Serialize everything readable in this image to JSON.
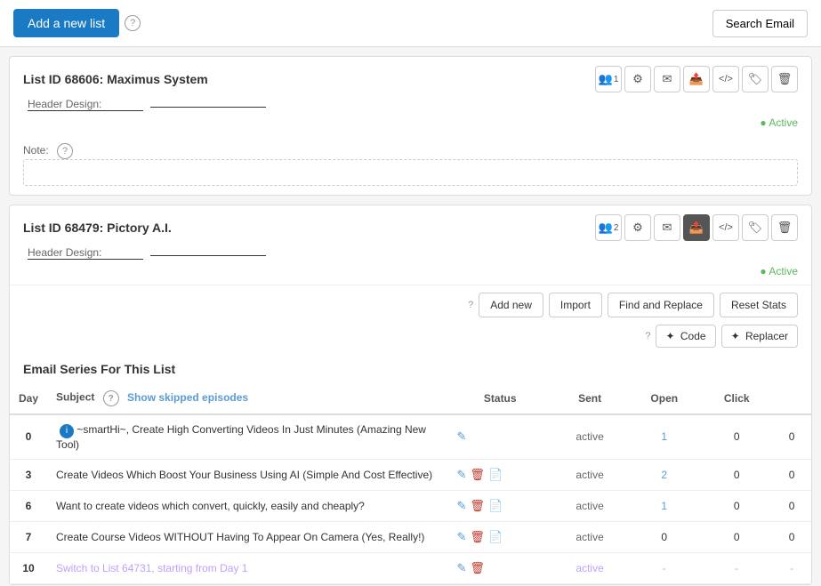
{
  "topBar": {
    "addNewLabel": "Add a new list",
    "searchEmailLabel": "Search Email"
  },
  "lists": [
    {
      "id": "list1",
      "title": "List ID 68606: Maximus System",
      "headerDesignLabel": "Header Design:",
      "status": "Active",
      "noteLabel": "Note:",
      "notePlaceholder": "",
      "iconButtons": [
        {
          "name": "users-icon",
          "symbol": "👥",
          "count": "1",
          "active": false
        },
        {
          "name": "settings-icon",
          "symbol": "⚙",
          "active": false
        },
        {
          "name": "envelope-icon",
          "symbol": "✉",
          "active": false
        },
        {
          "name": "send-icon",
          "symbol": "📨",
          "active": false
        },
        {
          "name": "code-icon",
          "symbol": "</>",
          "active": false
        },
        {
          "name": "tag-icon",
          "symbol": "🏷",
          "active": false
        },
        {
          "name": "trash-icon",
          "symbol": "🗑",
          "active": false
        }
      ]
    },
    {
      "id": "list2",
      "title": "List ID 68479: Pictory A.I.",
      "headerDesignLabel": "Header Design:",
      "status": "Active",
      "noteLabel": null,
      "iconButtons": [
        {
          "name": "users-icon",
          "symbol": "👥",
          "count": "2",
          "active": false
        },
        {
          "name": "settings-icon",
          "symbol": "⚙",
          "active": false
        },
        {
          "name": "envelope-icon",
          "symbol": "✉",
          "active": false
        },
        {
          "name": "send-icon",
          "symbol": "📨",
          "active": true
        },
        {
          "name": "code-icon",
          "symbol": "</>",
          "active": false
        },
        {
          "name": "tag-icon",
          "symbol": "🏷",
          "active": false
        },
        {
          "name": "trash-icon",
          "symbol": "🗑",
          "active": false
        }
      ],
      "actionsBar": {
        "addNewLabel": "Add new",
        "importLabel": "Import",
        "findReplaceLabel": "Find and Replace",
        "resetStatsLabel": "Reset Stats"
      },
      "codeBar": {
        "codeLabel": "✦ Code",
        "replacerLabel": "✦ Replacer"
      },
      "seriesTitle": "Email Series For This List",
      "tableHeaders": {
        "day": "Day",
        "subject": "Subject",
        "showSkipped": "Show skipped episodes",
        "status": "Status",
        "sent": "Sent",
        "open": "Open",
        "click": "Click"
      },
      "rows": [
        {
          "day": "0",
          "hasInfo": true,
          "subject": "~smartHi~, Create High Converting Videos In Just Minutes (Amazing New Tool)",
          "isSwitch": false,
          "status": "active",
          "sent": "1",
          "sentLink": true,
          "open": "0",
          "click": "0",
          "actions": [
            "edit"
          ]
        },
        {
          "day": "3",
          "hasInfo": false,
          "subject": "Create Videos Which Boost Your Business Using AI (Simple And Cost Effective)",
          "isSwitch": false,
          "status": "active",
          "sent": "2",
          "sentLink": true,
          "open": "0",
          "click": "0",
          "actions": [
            "edit",
            "trash",
            "copy"
          ]
        },
        {
          "day": "6",
          "hasInfo": false,
          "subject": "Want to create videos which convert, quickly, easily and cheaply?",
          "isSwitch": false,
          "status": "active",
          "sent": "1",
          "sentLink": true,
          "open": "0",
          "click": "0",
          "actions": [
            "edit",
            "trash",
            "copy"
          ]
        },
        {
          "day": "7",
          "hasInfo": false,
          "subject": "Create Course Videos WITHOUT Having To Appear On Camera (Yes, Really!)",
          "isSwitch": false,
          "status": "active",
          "sent": "0",
          "sentLink": false,
          "open": "0",
          "click": "0",
          "actions": [
            "edit",
            "trash",
            "copy"
          ]
        },
        {
          "day": "10",
          "hasInfo": false,
          "subject": "Switch to List 64731, starting from Day 1",
          "isSwitch": true,
          "status": "active",
          "sent": "-",
          "sentLink": false,
          "open": "-",
          "click": "-",
          "actions": [
            "edit",
            "trash"
          ]
        }
      ]
    }
  ]
}
